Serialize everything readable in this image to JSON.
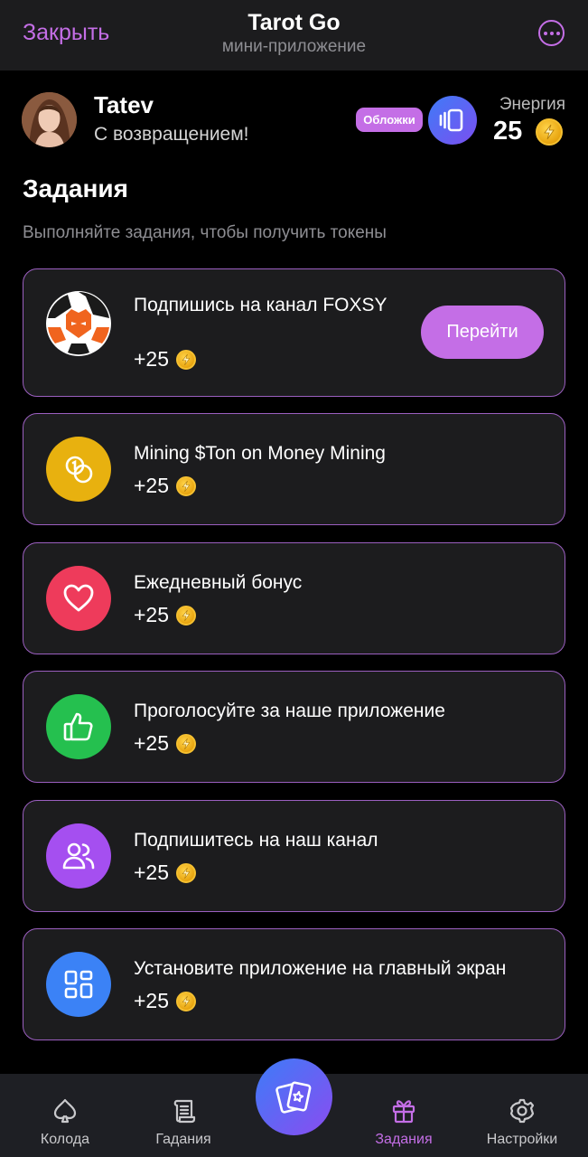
{
  "header": {
    "close_label": "Закрыть",
    "title": "Tarot Go",
    "subtitle": "мини-приложение"
  },
  "profile": {
    "name": "Tatev",
    "greeting": "С возвращением!",
    "covers_badge": "Обложки",
    "energy_label": "Энергия",
    "energy_value": "25"
  },
  "tasks_section": {
    "title": "Задания",
    "subtitle": "Выполняйте задания, чтобы получить токены"
  },
  "tasks": [
    {
      "title": "Подпишись на канал FOXSY",
      "reward": "+25",
      "button": "Перейти",
      "icon": "foxsy-logo-icon",
      "color": "#ffffff"
    },
    {
      "title": "Mining $Ton on Money Mining",
      "reward": "+25",
      "icon": "coins-icon",
      "color": "#e8b10f"
    },
    {
      "title": "Ежедневный бонус",
      "reward": "+25",
      "icon": "heart-icon",
      "color": "#ee3b5b"
    },
    {
      "title": "Проголосуйте за наше приложение",
      "reward": "+25",
      "icon": "thumbs-up-icon",
      "color": "#25c04f"
    },
    {
      "title": "Подпишитесь на наш канал",
      "reward": "+25",
      "icon": "users-icon",
      "color": "#a54ff0"
    },
    {
      "title": "Установите приложение на главный экран",
      "reward": "+25",
      "icon": "grid-icon",
      "color": "#3b82f6"
    }
  ],
  "nav": {
    "items": [
      {
        "label": "Колода",
        "icon": "spade-icon"
      },
      {
        "label": "Гадания",
        "icon": "scroll-icon"
      },
      {
        "label": "Задания",
        "icon": "gift-icon",
        "active": true
      },
      {
        "label": "Настройки",
        "icon": "gear-icon"
      }
    ],
    "center_icon": "cards-icon"
  },
  "colors": {
    "accent": "#c46ee6",
    "card_border": "#9b5fc0",
    "background": "#000000",
    "card_bg": "#1c1c1e"
  }
}
